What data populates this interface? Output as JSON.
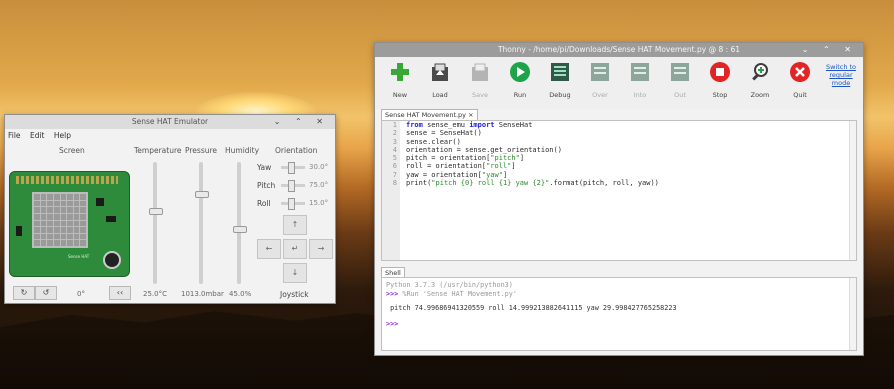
{
  "desktop": {
    "description_icons": []
  },
  "sense": {
    "title": "Sense HAT Emulator",
    "menu": [
      "File",
      "Edit",
      "Help"
    ],
    "headers": {
      "screen": "Screen",
      "temperature": "Temperature",
      "pressure": "Pressure",
      "humidity": "Humidity",
      "orientation": "Orientation"
    },
    "values": {
      "temperature": "25.0°C",
      "pressure": "1013.0mbar",
      "humidity": "45.0%",
      "rotation": "0°"
    },
    "orientation": [
      {
        "label": "Yaw",
        "value": "30.0°"
      },
      {
        "label": "Pitch",
        "value": "75.0°"
      },
      {
        "label": "Roll",
        "value": "15.0°"
      }
    ],
    "levels": {
      "temperature": 0.6,
      "pressure": 0.75,
      "humidity": 0.45
    },
    "joystick": {
      "label": "Joystick",
      "up": "↑",
      "down": "↓",
      "left": "←",
      "right": "→",
      "center": "↵"
    },
    "buttons": {
      "rot_ccw": "↻",
      "rot_cw": "↺",
      "extra": "‹‹"
    }
  },
  "thonny": {
    "title": "Thonny - /home/pi/Downloads/Sense HAT Movement.py @ 8 : 61",
    "toolbar": [
      {
        "label": "New",
        "icon": "new-icon",
        "enabled": true
      },
      {
        "label": "Load",
        "icon": "load-icon",
        "enabled": true
      },
      {
        "label": "Save",
        "icon": "save-icon",
        "enabled": false
      },
      {
        "label": "Run",
        "icon": "run-icon",
        "enabled": true
      },
      {
        "label": "Debug",
        "icon": "debug-icon",
        "enabled": true
      },
      {
        "label": "Over",
        "icon": "step-over-icon",
        "enabled": false
      },
      {
        "label": "Into",
        "icon": "step-into-icon",
        "enabled": false
      },
      {
        "label": "Out",
        "icon": "step-out-icon",
        "enabled": false
      },
      {
        "label": "Stop",
        "icon": "stop-icon",
        "enabled": true
      },
      {
        "label": "Zoom",
        "icon": "zoom-icon",
        "enabled": true
      },
      {
        "label": "Quit",
        "icon": "quit-icon",
        "enabled": true
      }
    ],
    "switch_mode": "Switch to regular mode",
    "tab": "Sense HAT Movement.py ×",
    "code_lines": [
      "from sense_emu import SenseHat",
      "sense = SenseHat()",
      "sense.clear()",
      "orientation = sense.get_orientation()",
      "pitch = orientation[\"pitch\"]",
      "roll = orientation[\"roll\"]",
      "yaw = orientation[\"yaw\"]",
      "print(\"pitch {0} roll {1} yaw {2}\".format(pitch, roll, yaw))"
    ],
    "shell_tab": "Shell",
    "shell": {
      "banner": "Python 3.7.3 (/usr/bin/python3)",
      "run_prompt": ">>>",
      "run_cmd": " %Run 'Sense HAT Movement.py'",
      "output": " pitch 74.99686941320559 roll 14.999213882641115 yaw 29.998427765258223",
      "prompt": ">>>"
    }
  },
  "colors": {
    "run_green": "#1fa34a",
    "stop_red": "#e32424",
    "new_green": "#3aa836"
  }
}
